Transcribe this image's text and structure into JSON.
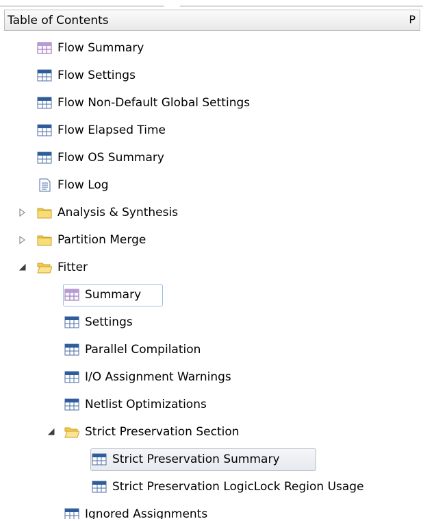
{
  "panel": {
    "title": "Table of Contents",
    "pin_glyph": "Ρ"
  },
  "colors": {
    "selection_border": "#9bbbe6",
    "table_header": "#2f5d9a",
    "folder": "#f2c94c"
  },
  "items": [
    {
      "label": "Flow Summary",
      "icon": "summary-table-icon"
    },
    {
      "label": "Flow Settings",
      "icon": "table-icon"
    },
    {
      "label": "Flow Non-Default Global Settings",
      "icon": "table-icon"
    },
    {
      "label": "Flow Elapsed Time",
      "icon": "table-icon"
    },
    {
      "label": "Flow OS Summary",
      "icon": "table-icon"
    },
    {
      "label": "Flow Log",
      "icon": "document-icon"
    },
    {
      "label": "Analysis & Synthesis",
      "icon": "folder-icon",
      "expander": "collapsed"
    },
    {
      "label": "Partition Merge",
      "icon": "folder-icon",
      "expander": "collapsed"
    },
    {
      "label": "Fitter",
      "icon": "folder-open-icon",
      "expander": "expanded"
    },
    {
      "label": "Summary",
      "icon": "summary-table-icon",
      "state": "focused"
    },
    {
      "label": "Settings",
      "icon": "table-icon"
    },
    {
      "label": "Parallel Compilation",
      "icon": "table-icon"
    },
    {
      "label": "I/O Assignment Warnings",
      "icon": "table-icon"
    },
    {
      "label": "Netlist Optimizations",
      "icon": "table-icon"
    },
    {
      "label": "Strict Preservation Section",
      "icon": "folder-open-icon",
      "expander": "expanded"
    },
    {
      "label": "Strict Preservation Summary",
      "icon": "table-icon",
      "state": "selected"
    },
    {
      "label": "Strict Preservation LogicLock Region Usage",
      "icon": "table-icon"
    },
    {
      "label": "Ignored Assignments",
      "icon": "table-icon"
    }
  ]
}
